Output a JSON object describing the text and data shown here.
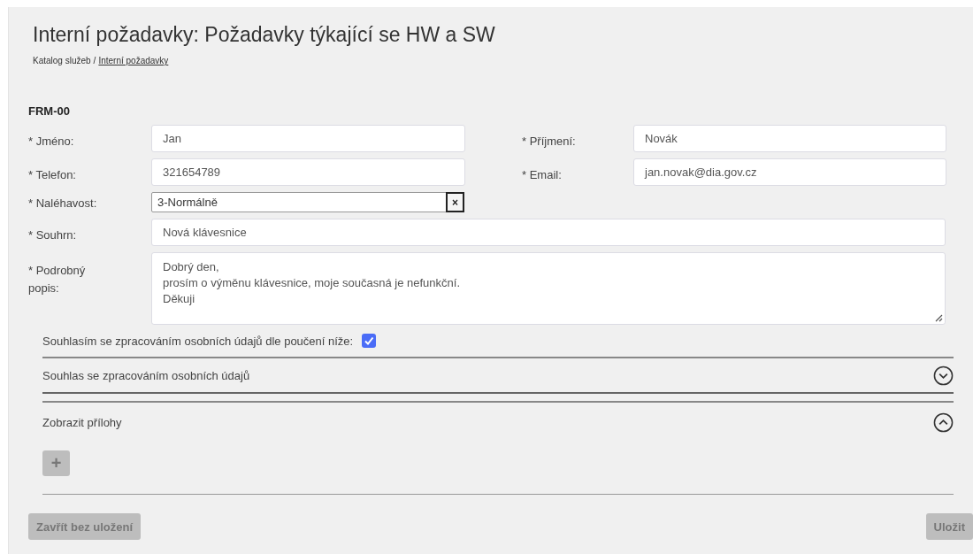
{
  "page": {
    "title": "Interní požadavky: Požadavky týkající se HW a SW"
  },
  "breadcrumb": [
    {
      "label": "Katalog služeb",
      "link": false
    },
    {
      "label": "Interní požadavky",
      "link": true
    }
  ],
  "breadcrumb_separator": "/",
  "form": {
    "code": "FRM-00",
    "rows": [
      {
        "kind": "pair",
        "fields": [
          {
            "label": "* Jméno:",
            "value": "Jan"
          },
          {
            "label": "* Příjmení:",
            "value": "Novák"
          }
        ]
      },
      {
        "kind": "pair",
        "fields": [
          {
            "label": "* Telefon:",
            "value": "321654789"
          },
          {
            "label": "* Email:",
            "value": "jan.novak@dia.gov.cz"
          }
        ]
      },
      {
        "kind": "select",
        "label": "* Naléhavost:",
        "value": "3-Normálně",
        "clear": "×"
      },
      {
        "kind": "wide",
        "label": "* Souhrn:",
        "value": "Nová klávesnice"
      },
      {
        "kind": "textarea",
        "label": "* Podrobný popis:",
        "value": "Dobrý den,\nprosím o výměnu klávesnice, moje současná je nefunkční.\nDěkuji"
      }
    ],
    "consent": {
      "label": "Souhlasím se zpracováním osobních údajů dle poučení níže:",
      "checked": true
    },
    "sections": [
      {
        "title": "Souhlas se zpracováním osobních údajů",
        "expanded": false
      },
      {
        "title": "Zobrazit přílohy",
        "expanded": true,
        "add_button": "+"
      }
    ]
  },
  "buttons": [
    {
      "label": "Zavřít bez uložení",
      "disabled": true
    },
    {
      "label": "Uložit",
      "disabled": true
    }
  ]
}
